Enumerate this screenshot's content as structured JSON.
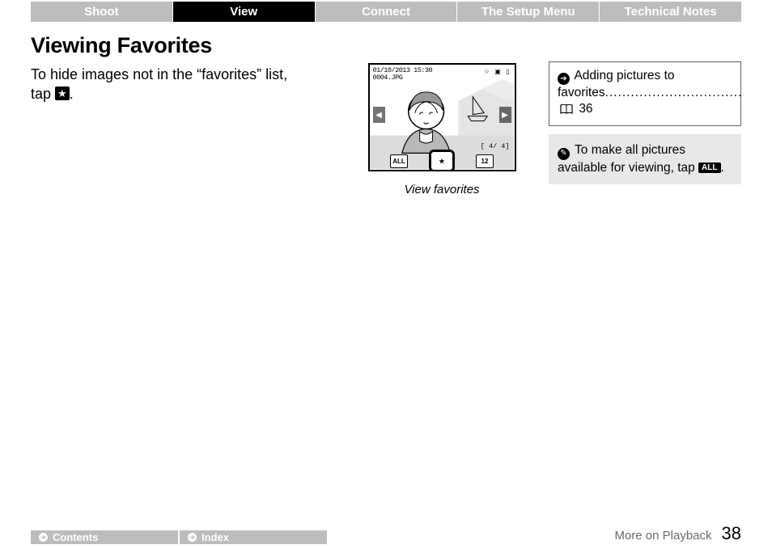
{
  "tabs": [
    "Shoot",
    "View",
    "Connect",
    "The Setup Menu",
    "Technical Notes"
  ],
  "active_tab_index": 1,
  "heading": "Viewing Favorites",
  "body": {
    "line1": "To hide images not in the “favorites” list,",
    "line2_before": "tap ",
    "star_glyph": "★",
    "line2_after": "."
  },
  "figure": {
    "datetime": "01/10/2013 15:30",
    "filename": "0004.JPG",
    "counter": "[   4/   4]",
    "buttons": {
      "all": "ALL",
      "star": "★",
      "thumbs": "12"
    },
    "top_icons": {
      "star": "☆",
      "gps": "▣",
      "card": "▯"
    },
    "caption": "View favorites"
  },
  "sidebar": {
    "link": {
      "text_before": "Adding pictures to",
      "text_line2": "favorites",
      "dots": "................................",
      "page_ref": "36"
    },
    "tip": {
      "text_before": "To make all pictures available for viewing, tap ",
      "btn_label": "ALL",
      "text_after": "."
    }
  },
  "footer": {
    "nav": [
      "Contents",
      "Index"
    ],
    "section": "More on Playback",
    "page": "38"
  }
}
